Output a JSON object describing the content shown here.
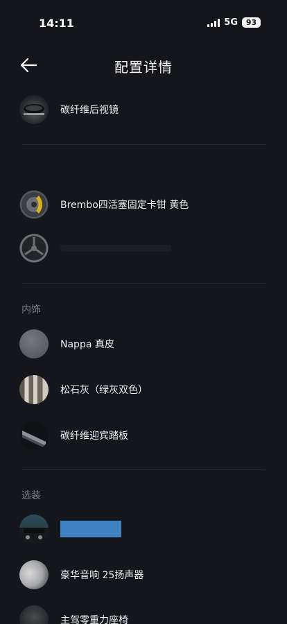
{
  "status": {
    "time": "14:11",
    "network": "5G",
    "battery": "93"
  },
  "header": {
    "title": "配置详情"
  },
  "sections": {
    "interior": "内饰",
    "options": "选装"
  },
  "items": {
    "mirror": "碳纤维后视镜",
    "brake": "Brembo四活塞固定卡钳 黄色",
    "leather": "Nappa 真皮",
    "color": "松石灰（绿灰双色）",
    "sill": "碳纤维迎宾踏板",
    "audio": "豪华音响 25扬声器",
    "seat": "主驾零重力座椅"
  }
}
